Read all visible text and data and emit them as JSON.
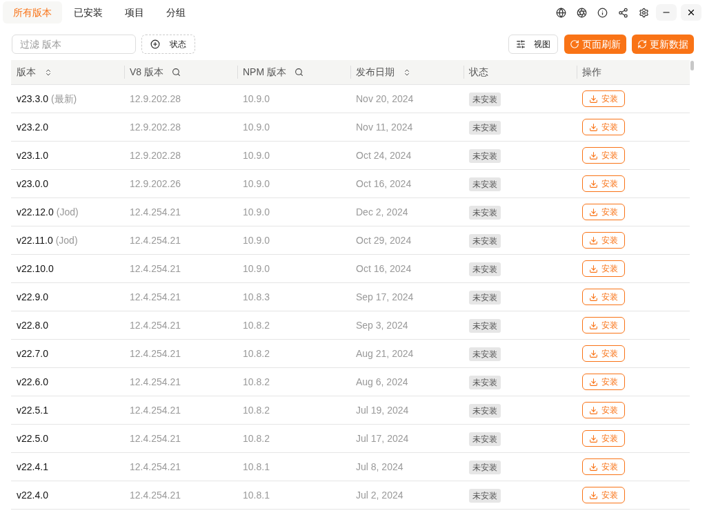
{
  "tabs": [
    {
      "label": "所有版本",
      "selected": true
    },
    {
      "label": "已安装",
      "selected": false
    },
    {
      "label": "项目",
      "selected": false
    },
    {
      "label": "分组",
      "selected": false
    }
  ],
  "toolbar": {
    "filter": {
      "placeholder": "过滤 版本"
    },
    "status_filter": "状态",
    "view_button": "视图",
    "refresh_button": "页面刷新",
    "update_button": "更新数据"
  },
  "table": {
    "columns": [
      {
        "label": "版本",
        "kind": "sort"
      },
      {
        "label": "V8 版本",
        "kind": "search"
      },
      {
        "label": "NPM 版本",
        "kind": "search"
      },
      {
        "label": "发布日期",
        "kind": "sort"
      },
      {
        "label": "状态",
        "kind": "plain"
      },
      {
        "label": "操作",
        "kind": "plain"
      }
    ],
    "rows": [
      {
        "version": "v23.3.0",
        "tag": "(最新)",
        "v8": "12.9.202.28",
        "npm": "10.9.0",
        "date": "Nov 20, 2024",
        "status": "未安装",
        "action": "安装"
      },
      {
        "version": "v23.2.0",
        "v8": "12.9.202.28",
        "npm": "10.9.0",
        "date": "Nov 11, 2024",
        "status": "未安装",
        "action": "安装"
      },
      {
        "version": "v23.1.0",
        "v8": "12.9.202.28",
        "npm": "10.9.0",
        "date": "Oct 24, 2024",
        "status": "未安装",
        "action": "安装"
      },
      {
        "version": "v23.0.0",
        "v8": "12.9.202.26",
        "npm": "10.9.0",
        "date": "Oct 16, 2024",
        "status": "未安装",
        "action": "安装"
      },
      {
        "version": "v22.12.0",
        "tag": "(Jod)",
        "v8": "12.4.254.21",
        "npm": "10.9.0",
        "date": "Dec 2, 2024",
        "status": "未安装",
        "action": "安装"
      },
      {
        "version": "v22.11.0",
        "tag": "(Jod)",
        "v8": "12.4.254.21",
        "npm": "10.9.0",
        "date": "Oct 29, 2024",
        "status": "未安装",
        "action": "安装"
      },
      {
        "version": "v22.10.0",
        "v8": "12.4.254.21",
        "npm": "10.9.0",
        "date": "Oct 16, 2024",
        "status": "未安装",
        "action": "安装"
      },
      {
        "version": "v22.9.0",
        "v8": "12.4.254.21",
        "npm": "10.8.3",
        "date": "Sep 17, 2024",
        "status": "未安装",
        "action": "安装"
      },
      {
        "version": "v22.8.0",
        "v8": "12.4.254.21",
        "npm": "10.8.2",
        "date": "Sep 3, 2024",
        "status": "未安装",
        "action": "安装"
      },
      {
        "version": "v22.7.0",
        "v8": "12.4.254.21",
        "npm": "10.8.2",
        "date": "Aug 21, 2024",
        "status": "未安装",
        "action": "安装"
      },
      {
        "version": "v22.6.0",
        "v8": "12.4.254.21",
        "npm": "10.8.2",
        "date": "Aug 6, 2024",
        "status": "未安装",
        "action": "安装"
      },
      {
        "version": "v22.5.1",
        "v8": "12.4.254.21",
        "npm": "10.8.2",
        "date": "Jul 19, 2024",
        "status": "未安装",
        "action": "安装"
      },
      {
        "version": "v22.5.0",
        "v8": "12.4.254.21",
        "npm": "10.8.2",
        "date": "Jul 17, 2024",
        "status": "未安装",
        "action": "安装"
      },
      {
        "version": "v22.4.1",
        "v8": "12.4.254.21",
        "npm": "10.8.1",
        "date": "Jul 8, 2024",
        "status": "未安装",
        "action": "安装"
      },
      {
        "version": "v22.4.0",
        "v8": "12.4.254.21",
        "npm": "10.8.1",
        "date": "Jul 2, 2024",
        "status": "未安装",
        "action": "安装"
      }
    ]
  }
}
